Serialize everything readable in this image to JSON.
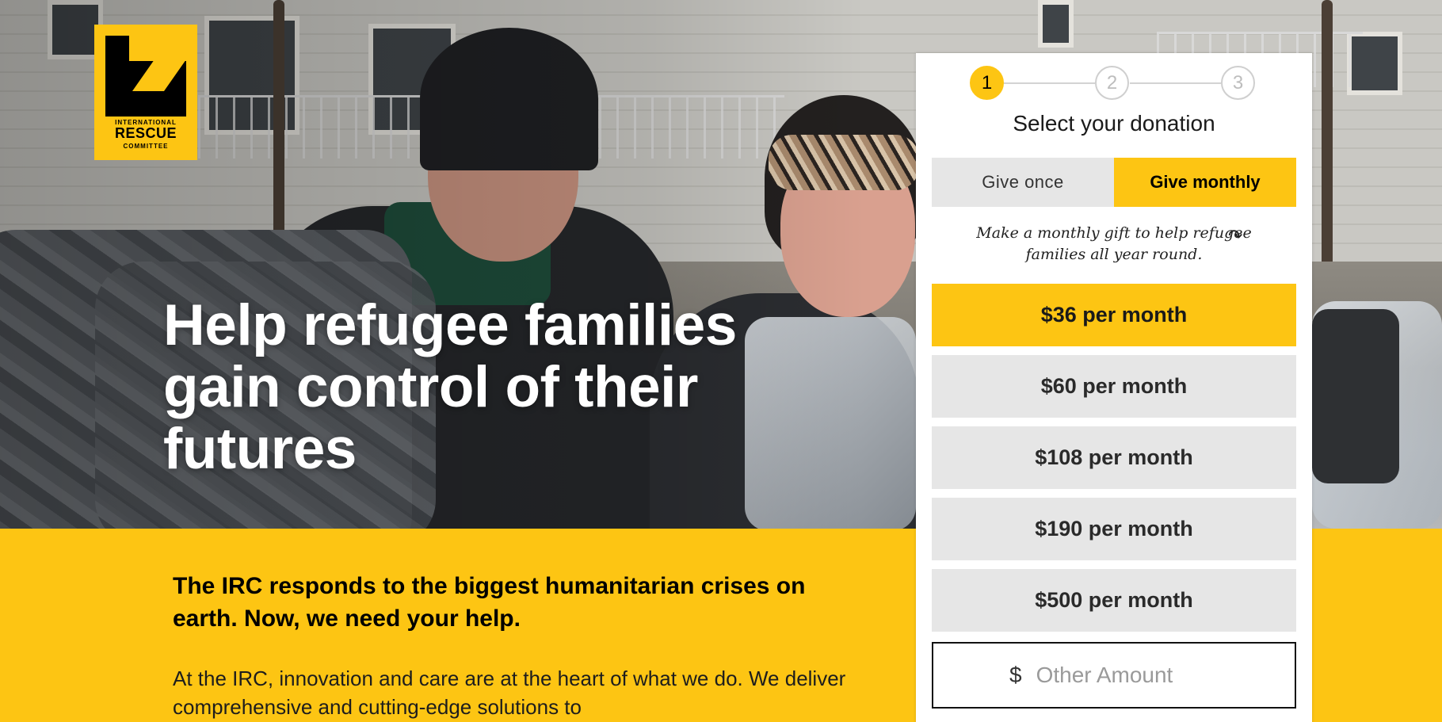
{
  "brand": {
    "logo_line1": "INTERNATIONAL",
    "logo_line2": "RESCUE",
    "logo_line3": "COMMITTEE",
    "yellow": "#fdc513"
  },
  "hero": {
    "headline": "Help refugee families gain control of their futures"
  },
  "content": {
    "subhead": "The IRC responds to the biggest humanitarian crises on earth. Now, we need your help.",
    "body": "At the IRC, innovation and care are at the heart of what we do. We deliver comprehensive and cutting-edge solutions to"
  },
  "donation": {
    "steps": [
      "1",
      "2",
      "3"
    ],
    "current_step": 1,
    "title": "Select your donation",
    "toggle": {
      "once_label": "Give once",
      "monthly_label": "Give monthly",
      "selected": "monthly"
    },
    "note": "Make a monthly gift to help refugee families all year round.",
    "amounts": [
      {
        "label": "$36 per month",
        "selected": true
      },
      {
        "label": "$60 per month",
        "selected": false
      },
      {
        "label": "$108 per month",
        "selected": false
      },
      {
        "label": "$190 per month",
        "selected": false
      },
      {
        "label": "$500 per month",
        "selected": false
      }
    ],
    "other": {
      "currency": "$",
      "placeholder": "Other Amount"
    }
  }
}
